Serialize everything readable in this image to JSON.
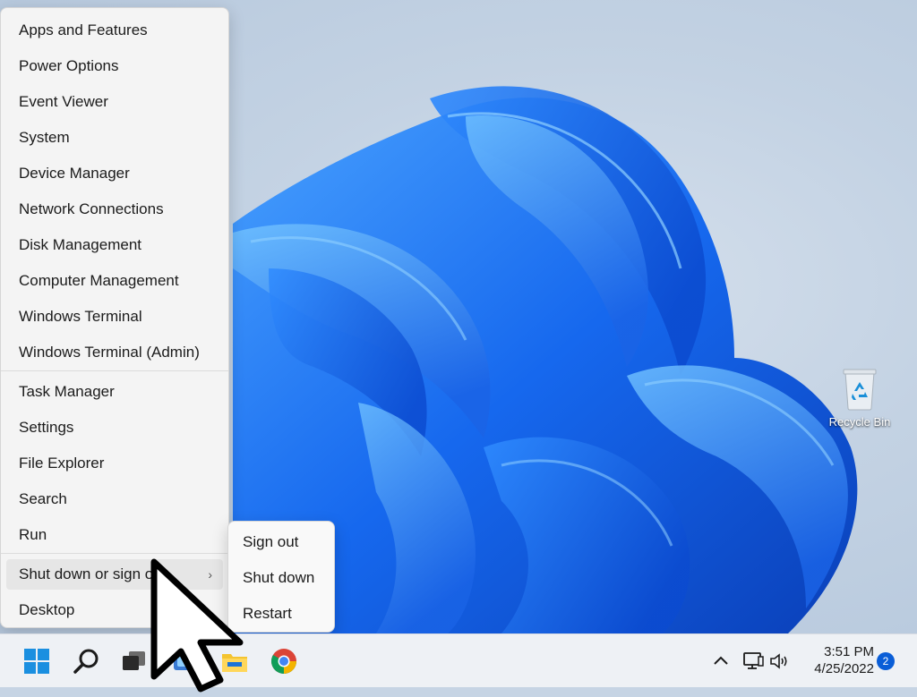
{
  "desktop": {
    "recycle_bin_label": "Recycle Bin"
  },
  "power_menu": {
    "items": [
      {
        "label": "Apps and Features"
      },
      {
        "label": "Power Options"
      },
      {
        "label": "Event Viewer"
      },
      {
        "label": "System"
      },
      {
        "label": "Device Manager"
      },
      {
        "label": "Network Connections"
      },
      {
        "label": "Disk Management"
      },
      {
        "label": "Computer Management"
      },
      {
        "label": "Windows Terminal"
      },
      {
        "label": "Windows Terminal (Admin)"
      },
      {
        "label": "Task Manager"
      },
      {
        "label": "Settings"
      },
      {
        "label": "File Explorer"
      },
      {
        "label": "Search"
      },
      {
        "label": "Run"
      },
      {
        "label": "Shut down or sign out",
        "icon": "chevron-right-icon"
      },
      {
        "label": "Desktop"
      }
    ]
  },
  "shutdown_submenu": {
    "items": [
      {
        "label": "Sign out"
      },
      {
        "label": "Shut down"
      },
      {
        "label": "Restart"
      }
    ]
  },
  "taskbar": {
    "icons": [
      "windows-start-icon",
      "search-icon",
      "task-view-icon",
      "widgets-icon",
      "file-explorer-icon",
      "chrome-icon"
    ],
    "tray": {
      "icons": [
        "chevron-up-icon",
        "network-icon",
        "volume-icon"
      ],
      "time": "3:51 PM",
      "date": "4/25/2022",
      "notification_count": "2"
    }
  },
  "colors": {
    "accent": "#0a5ed7",
    "bloom": "#1565e8"
  }
}
